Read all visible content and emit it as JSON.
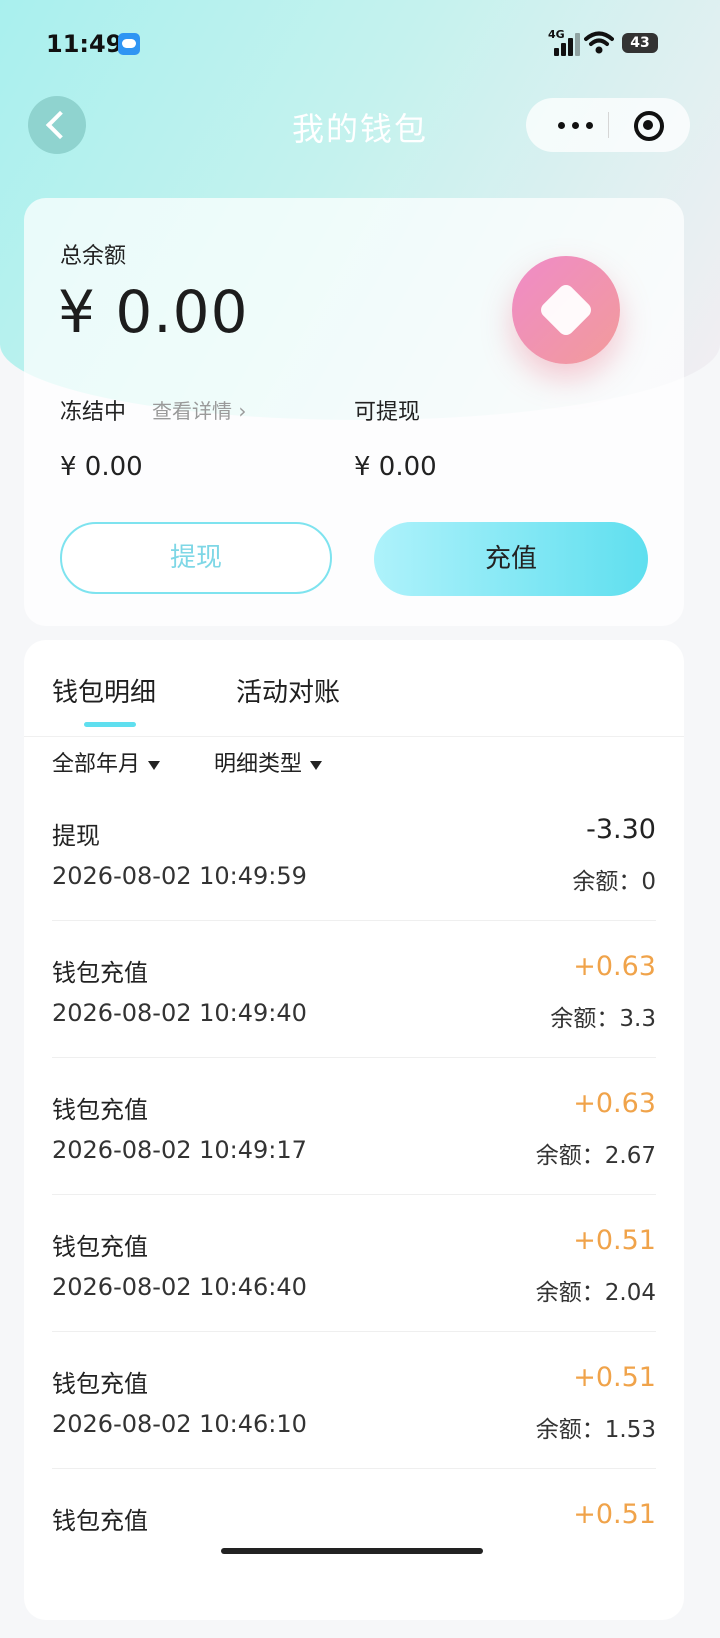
{
  "status_bar": {
    "time": "11:49",
    "network": "4G",
    "battery": "43",
    "icons": [
      "weather-icon",
      "signal-icon",
      "wifi-icon",
      "battery-icon"
    ]
  },
  "nav": {
    "title": "我的钱包",
    "icons": [
      "back-icon",
      "more-icon",
      "close-target-icon"
    ]
  },
  "balance": {
    "total_label": "总余额",
    "total_amount": "¥ 0.00",
    "frozen_label": "冻结中",
    "details_link": "查看详情 ›",
    "frozen_amount": "¥ 0.00",
    "withdrawable_label": "可提现",
    "withdrawable_amount": "¥ 0.00",
    "withdraw_button": "提现",
    "recharge_button": "充值"
  },
  "details": {
    "tabs": [
      "钱包明细",
      "活动对账"
    ],
    "active_tab": 0,
    "filters": [
      "全部年月",
      "明细类型"
    ],
    "records": [
      {
        "name": "提现",
        "date": "2026-08-02 10:49:59",
        "amount": "-3.30",
        "balance": "余额：0"
      },
      {
        "name": "钱包充值",
        "date": "2026-08-02 10:49:40",
        "amount": "+0.63",
        "balance": "余额：3.3"
      },
      {
        "name": "钱包充值",
        "date": "2026-08-02 10:49:17",
        "amount": "+0.63",
        "balance": "余额：2.67"
      },
      {
        "name": "钱包充值",
        "date": "2026-08-02 10:46:40",
        "amount": "+0.51",
        "balance": "余额：2.04"
      },
      {
        "name": "钱包充值",
        "date": "2026-08-02 10:46:10",
        "amount": "+0.51",
        "balance": "余额：1.53"
      },
      {
        "name": "钱包充值",
        "date": "",
        "amount": "+0.51",
        "balance": ""
      }
    ]
  },
  "colors": {
    "accent": "#5fdfef",
    "positive_amount": "#f0a34a",
    "badge_gradient_start": "#ef8bc8",
    "badge_gradient_end": "#f29b9a"
  }
}
